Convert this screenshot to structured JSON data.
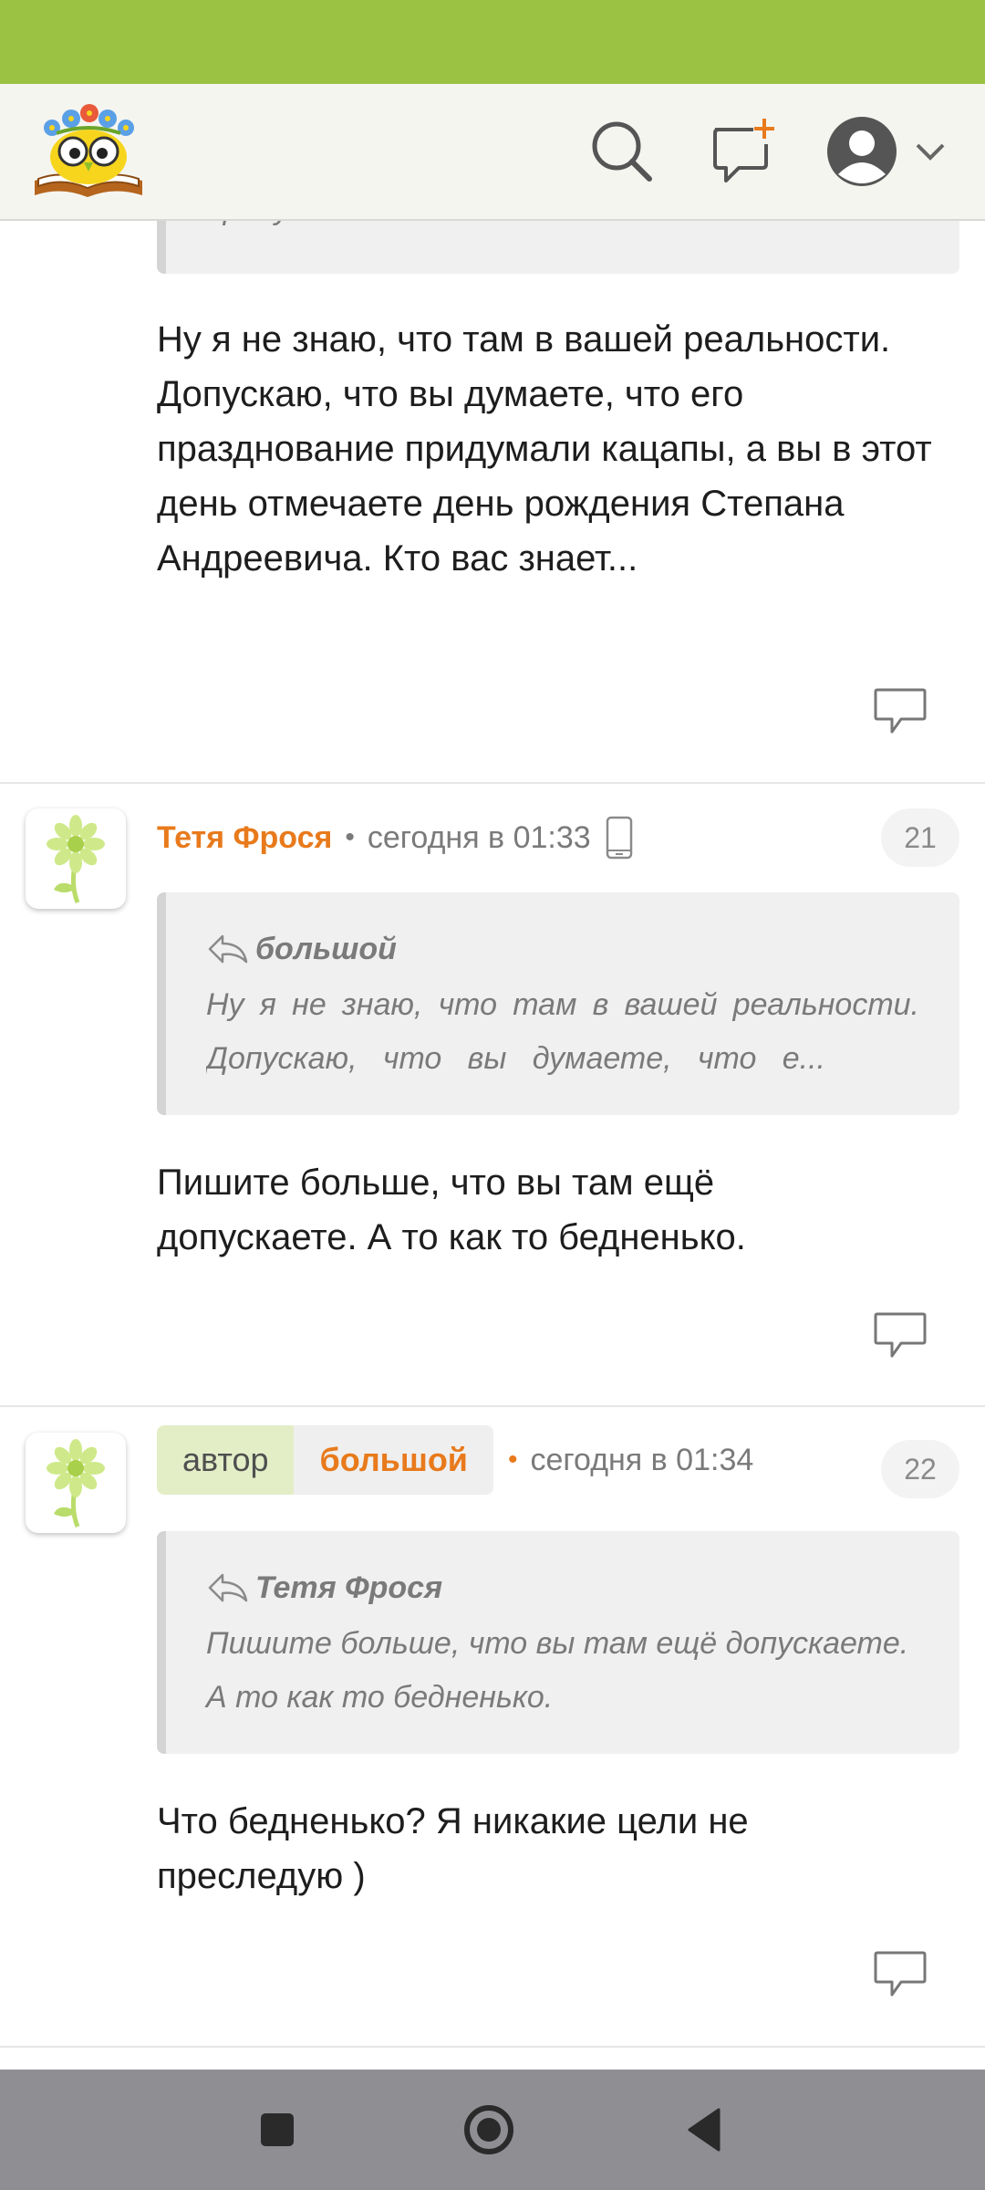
{
  "header": {
    "logo_icon": "owl-on-book-logo",
    "search_icon": "search-icon",
    "new_message_icon": "new-message-icon",
    "profile_icon": "user-avatar-icon"
  },
  "first_post": {
    "quote_tail": "придумали.",
    "body": "Ну я не знаю, что там в вашей реальности. Допускаю, что вы думаете, что его празднование придумали кацапы, а вы в этот день отмечаете день рождения Степана Андреевича. Кто вас знает..."
  },
  "comments": [
    {
      "author": "Тетя Фрося",
      "time": "сегодня в 01:33",
      "number": "21",
      "device_icon": "mobile-phone-icon",
      "quote_author": "большой",
      "quote_line1": "Ну я не знаю, что там в вашей реальности.",
      "quote_line2": "Допускаю,   что   вы   думаете,   что   е...",
      "body": "Пишите больше, что вы там ещё допускаете. А то как то бедненько."
    },
    {
      "author_label": "автор",
      "author": "большой",
      "time": "сегодня в 01:34",
      "number": "22",
      "quote_author": "Тетя Фрося",
      "quote_line1": "Пишите больше, что вы там ещё допускаете.",
      "quote_line2": "А то как то бедненько.",
      "body": "Что бедненько? Я никакие цели не преследую )"
    }
  ],
  "colors": {
    "status_bar": "#9cc244",
    "accent_orange": "#e87a1c",
    "author_chip": "#e3eec7",
    "nav_bar": "#8e8e93"
  }
}
